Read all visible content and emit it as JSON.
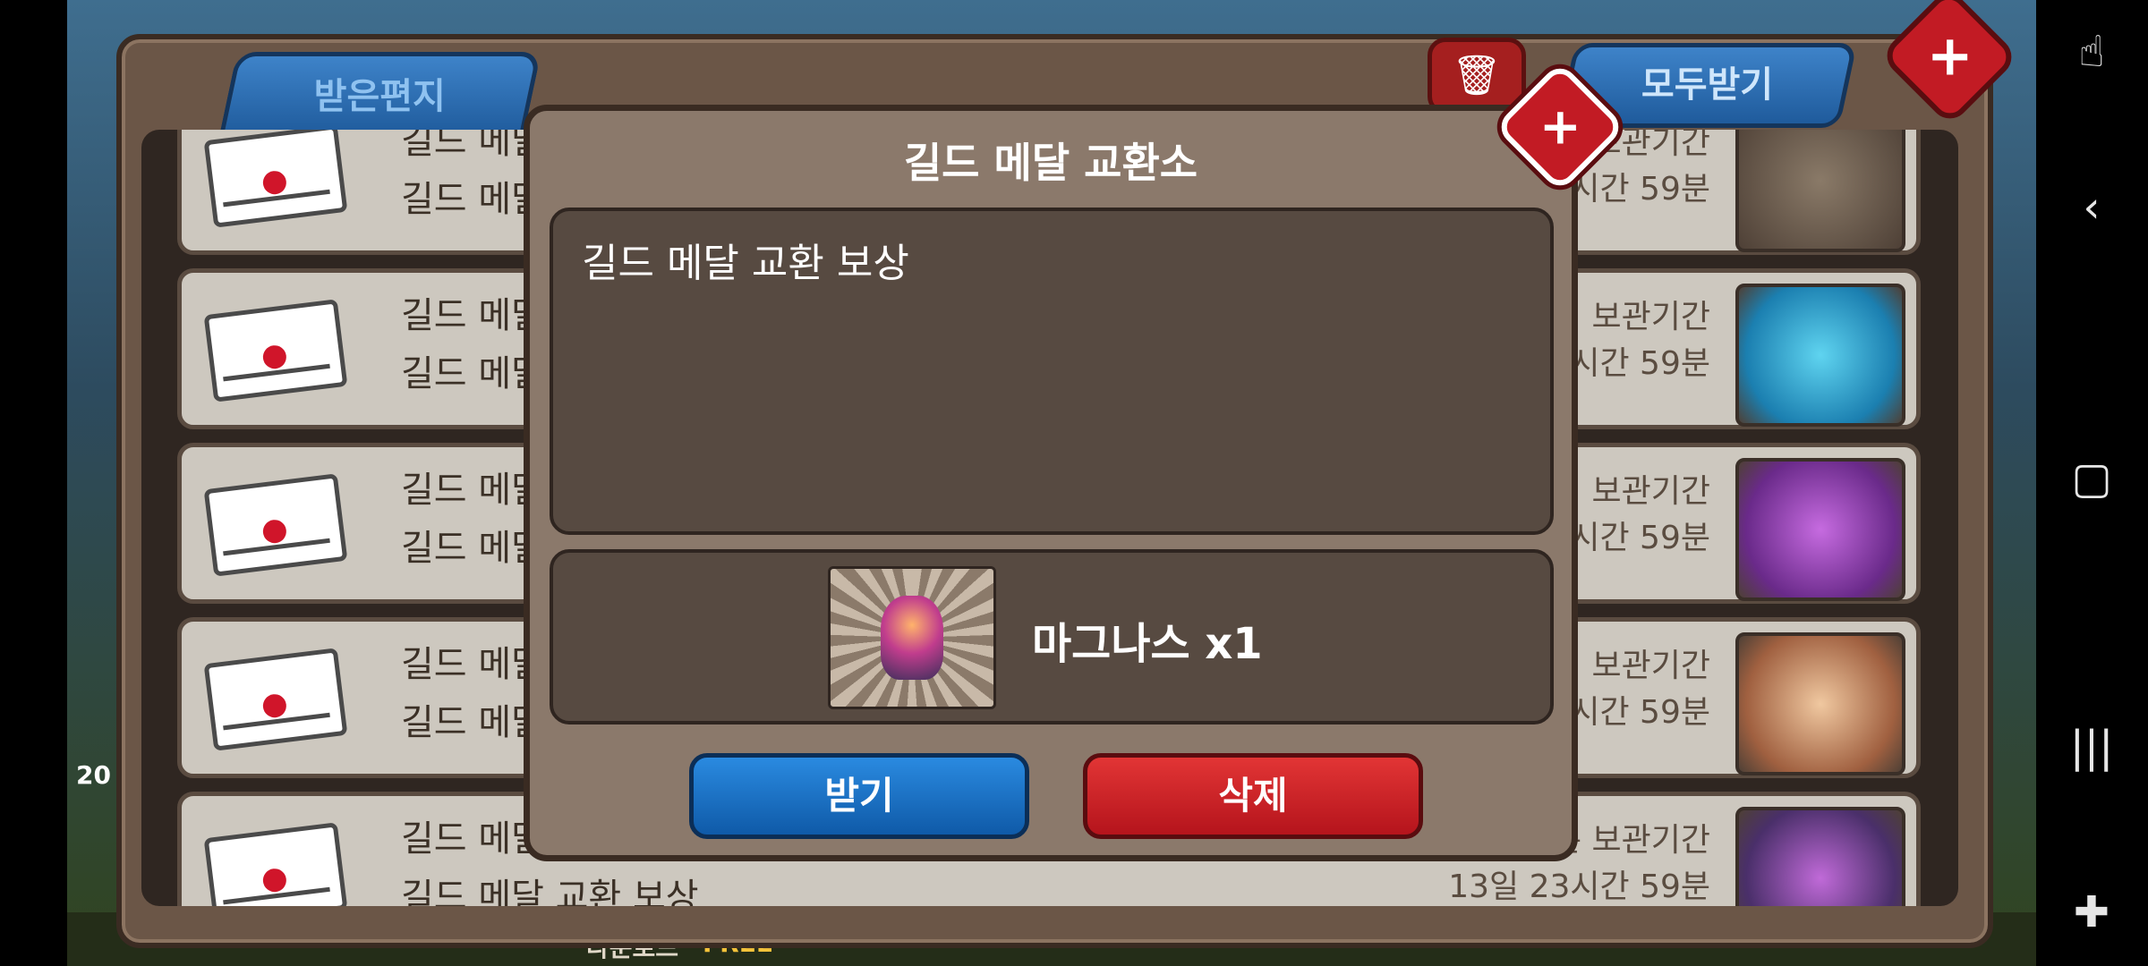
{
  "header": {
    "tab_received": "받은편지",
    "receive_all": "모두받기",
    "trash_icon": "trash-icon",
    "close_icon": "close-icon"
  },
  "mail_rows": [
    {
      "title": "길드 메달",
      "subtitle": "길드 메달",
      "expire_label": "보관기간",
      "expire_time": "시간 59분",
      "item_icon": "guild-emblem-icon"
    },
    {
      "title": "길드 메달",
      "subtitle": "길드 메달",
      "expire_label": "보관기간",
      "expire_time": "시간 59분",
      "item_icon": "potion-icon"
    },
    {
      "title": "길드 메달",
      "subtitle": "길드 메달",
      "expire_label": "보관기간",
      "expire_time": "시간 59분",
      "item_icon": "level-up-icon"
    },
    {
      "title": "길드 메달",
      "subtitle": "길드 메달",
      "expire_label": "보관기간",
      "expire_time": "시간 59분",
      "item_icon": "egg-icon"
    },
    {
      "title": "길드 메달 교환소",
      "subtitle": "길드 메달 교환 보상",
      "expire_label": "남은 보관기간",
      "expire_time": "13일 23시간 59분",
      "item_icon": "magnus-icon"
    }
  ],
  "dialog": {
    "title": "길드 메달 교환소",
    "message": "길드 메달 교환 보상",
    "reward_label": "마그나스 x1",
    "reward_icon": "magnus-icon",
    "receive_button": "받기",
    "delete_button": "삭제"
  },
  "background_text": {
    "download": "다운로드",
    "free": "FREE",
    "level": "20"
  },
  "navbar_icons": [
    "touch-icon",
    "back-icon",
    "home-icon",
    "recents-icon",
    "game-tools-icon"
  ],
  "colors": {
    "accent_blue": "#1f5b9c",
    "accent_red": "#c21b24",
    "panel": "#8b796b"
  }
}
